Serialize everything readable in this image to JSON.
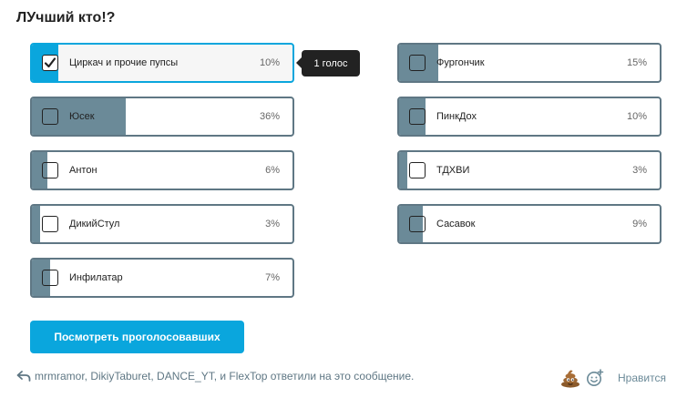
{
  "poll": {
    "title": "ЛУчший кто!?",
    "options": [
      {
        "label": "Циркач и прочие пупсы",
        "percent": "10%",
        "fill": 0.1,
        "selected": true
      },
      {
        "label": "Юсек",
        "percent": "36%",
        "fill": 0.36,
        "selected": false
      },
      {
        "label": "Антон",
        "percent": "6%",
        "fill": 0.06,
        "selected": false
      },
      {
        "label": "ДикийСтул",
        "percent": "3%",
        "fill": 0.03,
        "selected": false
      },
      {
        "label": "Инфилатар",
        "percent": "7%",
        "fill": 0.07,
        "selected": false
      },
      {
        "label": "Фургончик",
        "percent": "15%",
        "fill": 0.15,
        "selected": false
      },
      {
        "label": "ПинкДох",
        "percent": "10%",
        "fill": 0.1,
        "selected": false
      },
      {
        "label": "ТДХВИ",
        "percent": "3%",
        "fill": 0.03,
        "selected": false
      },
      {
        "label": "Сасавок",
        "percent": "9%",
        "fill": 0.09,
        "selected": false
      }
    ],
    "tooltip": "1 голос",
    "view_voters_label": "Посмотреть проголосовавших"
  },
  "footer": {
    "replies_text": "mrmramor, DikiyTaburet, DANCE_YT, и FlexTop ответили на это сообщение.",
    "like_label": "Нравится",
    "reply_icon": "reply-arrow-icon",
    "reaction_icon": "poop-emoji-icon",
    "add_reaction_icon": "add-reaction-icon"
  },
  "colors": {
    "accent": "#0aa6dd",
    "bar_fill": "#6b8a98",
    "border": "#5f7784"
  }
}
